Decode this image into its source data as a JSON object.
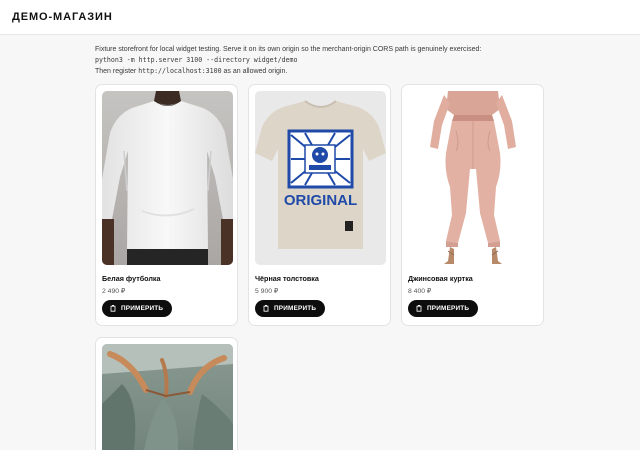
{
  "header": {
    "brand": "ДЕМО-МАГАЗИН"
  },
  "intro": {
    "line1": "Fixture storefront for local widget testing. Serve it on its own origin so the merchant-origin CORS path is genuinely exercised:",
    "command": "python3 -m http.server 3100 --directory widget/demo",
    "line3_prefix": "Then register ",
    "line3_url": "http://localhost:3100",
    "line3_suffix": " as an allowed origin."
  },
  "products": [
    {
      "name": "Белая футболка",
      "price": "2 490 ₽",
      "button": "ПРИМЕРИТЬ"
    },
    {
      "name": "Чёрная толстовка",
      "price": "5 900 ₽",
      "button": "ПРИМЕРИТЬ"
    },
    {
      "name": "Джинсовая куртка",
      "price": "8 400 ₽",
      "button": "ПРИМЕРИТЬ"
    },
    {
      "name": "",
      "price": "",
      "button": ""
    }
  ],
  "graphics": {
    "tee_print_text": "ORIGINAL"
  },
  "colors": {
    "button_bg": "#0d0d0d",
    "header_bg": "#ffffff",
    "page_bg": "#f7f7f7"
  }
}
